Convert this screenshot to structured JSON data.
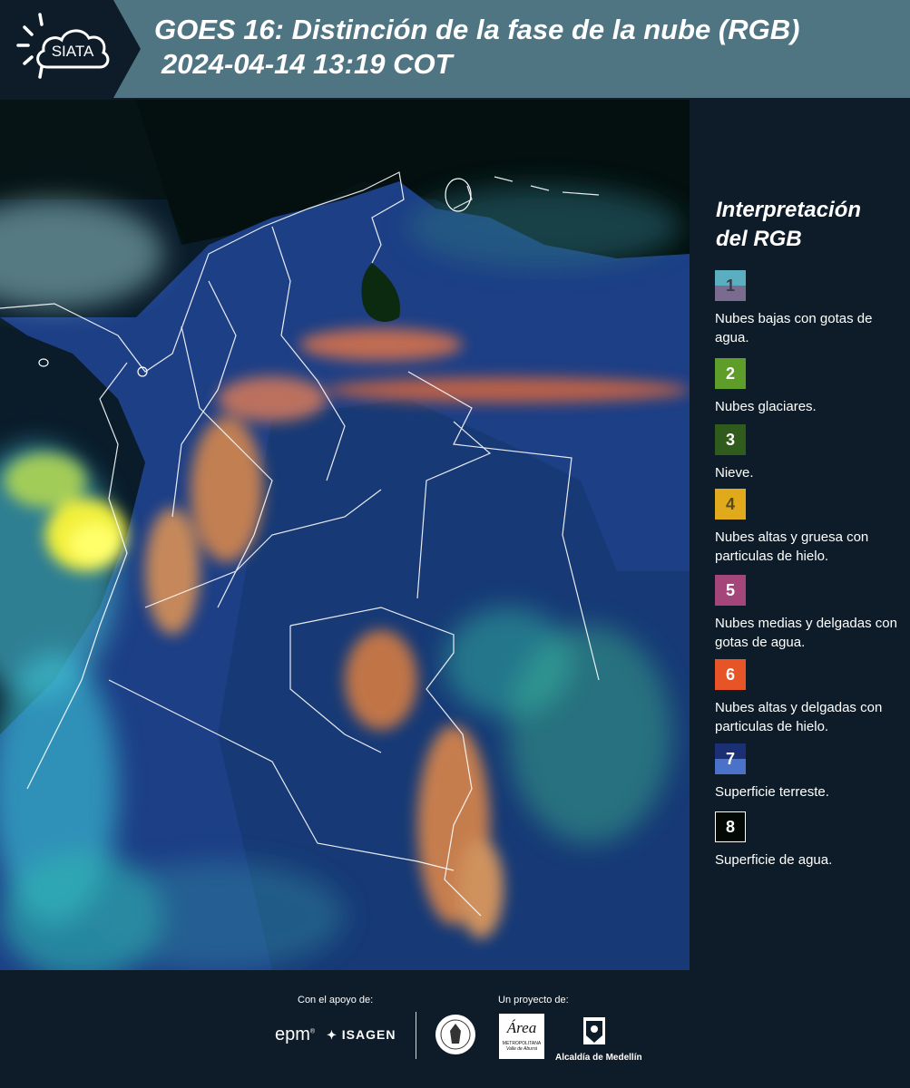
{
  "header": {
    "logo_text": "SIATA",
    "title_line1": "GOES 16: Distinción de la fase de la nube (RGB)",
    "title_line2": "2024-04-14 13:19 COT",
    "bg_color": "#4f7482"
  },
  "legend": {
    "title": "Interpretación del RGB",
    "items": [
      {
        "num": "1",
        "text": "Nubes bajas con gotas de agua.",
        "color_top": "#5aaec0",
        "color_bottom": "#7a6c8e"
      },
      {
        "num": "2",
        "text": "Nubes glaciares.",
        "color_top": "#5e9d2a",
        "color_bottom": "#5e9d2a"
      },
      {
        "num": "3",
        "text": "Nieve.",
        "color_top": "#2f5c1c",
        "color_bottom": "#2f5c1c"
      },
      {
        "num": "4",
        "text": "Nubes altas y gruesa con particulas de hielo.",
        "color_top": "#e0aa1c",
        "color_bottom": "#e0aa1c"
      },
      {
        "num": "5",
        "text": "Nubes medias y delgadas con gotas de agua.",
        "color_top": "#a5467a",
        "color_bottom": "#a5467a"
      },
      {
        "num": "6",
        "text": "Nubes altas y delgadas con particulas de hielo.",
        "color_top": "#e65428",
        "color_bottom": "#e65428"
      },
      {
        "num": "7",
        "text": "Superficie terreste.",
        "color_top": "#1a2f74",
        "color_bottom": "#4a72c8"
      },
      {
        "num": "8",
        "text": "Superficie de agua.",
        "color_top": "#030a05",
        "color_bottom": "#030a05"
      }
    ]
  },
  "footer": {
    "support_label": "Con el apoyo de:",
    "project_label": "Un proyecto de:",
    "epm": "epm",
    "isagen": "ISAGEN",
    "area_name": "Área",
    "area_sub1": "METROPOLITANA",
    "area_sub2": "Valle de Aburrá",
    "alcaldia": "Alcaldía de Medellín"
  },
  "map": {
    "image_name": "goes16-cloud-phase-rgb-colombia"
  }
}
